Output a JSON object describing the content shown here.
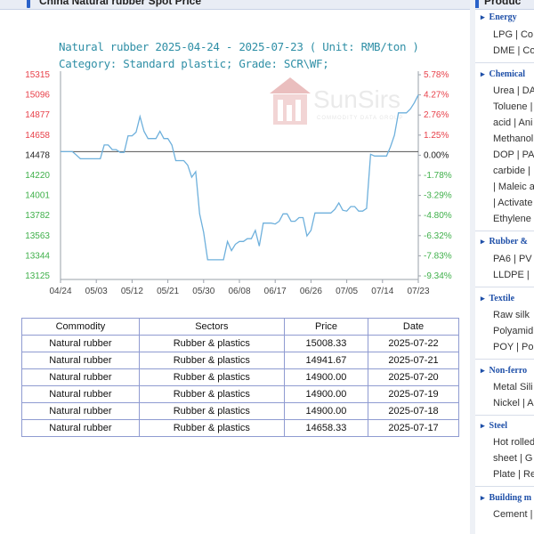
{
  "page": {
    "title": "China Natural rubber Spot Price"
  },
  "chart": {
    "title": "Natural rubber 2025-04-24 - 2025-07-23   ( Unit: RMB/ton )",
    "subtitle": "Category: Standard plastic; Grade: SCR\\WF;",
    "watermark": "SunSirs",
    "watermark_sub": "COMMODITY DATA GROUP"
  },
  "chart_data": {
    "type": "line",
    "title": "Natural rubber 2025-04-24 - 2025-07-23   ( Unit: RMB/ton )",
    "xlabel": "",
    "ylabel": "",
    "ylim": [
      13125,
      15315
    ],
    "y_ticks_left": [
      "15315",
      "15096",
      "14877",
      "14658",
      "14478",
      "14220",
      "14001",
      "13782",
      "13563",
      "13344",
      "13125"
    ],
    "y_ticks_right": [
      "5.78%",
      "4.27%",
      "2.76%",
      "1.25%",
      "0.00%",
      "-1.78%",
      "-3.29%",
      "-4.80%",
      "-6.32%",
      "-7.83%",
      "-9.34%"
    ],
    "x_ticks": [
      "04/24",
      "05/03",
      "05/12",
      "05/21",
      "05/30",
      "06/08",
      "06/17",
      "06/26",
      "07/05",
      "07/14",
      "07/23"
    ],
    "grid": false,
    "baseline": 14478,
    "series": [
      {
        "color": "#6eb0dc",
        "points": [
          [
            "04/24",
            14478
          ],
          [
            "04/25",
            14478
          ],
          [
            "04/26",
            14478
          ],
          [
            "04/27",
            14478
          ],
          [
            "04/28",
            14440
          ],
          [
            "04/29",
            14400
          ],
          [
            "04/30",
            14400
          ],
          [
            "05/01",
            14400
          ],
          [
            "05/02",
            14400
          ],
          [
            "05/03",
            14400
          ],
          [
            "05/04",
            14400
          ],
          [
            "05/05",
            14550
          ],
          [
            "05/06",
            14550
          ],
          [
            "05/07",
            14500
          ],
          [
            "05/08",
            14500
          ],
          [
            "05/09",
            14470
          ],
          [
            "05/10",
            14470
          ],
          [
            "05/11",
            14650
          ],
          [
            "05/12",
            14650
          ],
          [
            "05/13",
            14690
          ],
          [
            "05/14",
            14860
          ],
          [
            "05/15",
            14700
          ],
          [
            "05/16",
            14620
          ],
          [
            "05/17",
            14620
          ],
          [
            "05/18",
            14620
          ],
          [
            "05/19",
            14700
          ],
          [
            "05/20",
            14620
          ],
          [
            "05/21",
            14620
          ],
          [
            "05/22",
            14550
          ],
          [
            "05/23",
            14380
          ],
          [
            "05/24",
            14380
          ],
          [
            "05/25",
            14380
          ],
          [
            "05/26",
            14330
          ],
          [
            "05/27",
            14200
          ],
          [
            "05/28",
            14260
          ],
          [
            "05/29",
            13800
          ],
          [
            "05/30",
            13600
          ],
          [
            "05/31",
            13300
          ],
          [
            "06/01",
            13300
          ],
          [
            "06/02",
            13300
          ],
          [
            "06/03",
            13300
          ],
          [
            "06/04",
            13300
          ],
          [
            "06/05",
            13500
          ],
          [
            "06/06",
            13400
          ],
          [
            "06/07",
            13470
          ],
          [
            "06/08",
            13500
          ],
          [
            "06/09",
            13500
          ],
          [
            "06/10",
            13530
          ],
          [
            "06/11",
            13530
          ],
          [
            "06/12",
            13620
          ],
          [
            "06/13",
            13450
          ],
          [
            "06/14",
            13700
          ],
          [
            "06/15",
            13700
          ],
          [
            "06/16",
            13700
          ],
          [
            "06/17",
            13690
          ],
          [
            "06/18",
            13720
          ],
          [
            "06/19",
            13800
          ],
          [
            "06/20",
            13800
          ],
          [
            "06/21",
            13720
          ],
          [
            "06/22",
            13720
          ],
          [
            "06/23",
            13760
          ],
          [
            "06/24",
            13760
          ],
          [
            "06/25",
            13560
          ],
          [
            "06/26",
            13620
          ],
          [
            "06/27",
            13810
          ],
          [
            "06/28",
            13810
          ],
          [
            "06/29",
            13810
          ],
          [
            "06/30",
            13810
          ],
          [
            "07/01",
            13810
          ],
          [
            "07/02",
            13850
          ],
          [
            "07/03",
            13920
          ],
          [
            "07/04",
            13840
          ],
          [
            "07/05",
            13830
          ],
          [
            "07/06",
            13880
          ],
          [
            "07/07",
            13880
          ],
          [
            "07/08",
            13830
          ],
          [
            "07/09",
            13830
          ],
          [
            "07/10",
            13860
          ],
          [
            "07/11",
            14450
          ],
          [
            "07/12",
            14430
          ],
          [
            "07/13",
            14430
          ],
          [
            "07/14",
            14430
          ],
          [
            "07/15",
            14430
          ],
          [
            "07/16",
            14530
          ],
          [
            "07/17",
            14658.33
          ],
          [
            "07/18",
            14900
          ],
          [
            "07/19",
            14900
          ],
          [
            "07/20",
            14900
          ],
          [
            "07/21",
            14941.67
          ],
          [
            "07/22",
            15008.33
          ],
          [
            "07/23",
            15096
          ]
        ]
      }
    ]
  },
  "table": {
    "headers": [
      "Commodity",
      "Sectors",
      "Price",
      "Date"
    ],
    "rows": [
      [
        "Natural rubber",
        "Rubber & plastics",
        "15008.33",
        "2025-07-22"
      ],
      [
        "Natural rubber",
        "Rubber & plastics",
        "14941.67",
        "2025-07-21"
      ],
      [
        "Natural rubber",
        "Rubber & plastics",
        "14900.00",
        "2025-07-20"
      ],
      [
        "Natural rubber",
        "Rubber & plastics",
        "14900.00",
        "2025-07-19"
      ],
      [
        "Natural rubber",
        "Rubber & plastics",
        "14900.00",
        "2025-07-18"
      ],
      [
        "Natural rubber",
        "Rubber & plastics",
        "14658.33",
        "2025-07-17"
      ]
    ]
  },
  "sidebar": {
    "title": "Produc",
    "categories": [
      {
        "label": "Energy",
        "items": [
          "LPG | Co",
          "DME | Co"
        ]
      },
      {
        "label": "Chemical",
        "items": [
          "Urea | DA",
          "Toluene |",
          "acid | Ani",
          "Methanol",
          "DOP | PA",
          "carbide |",
          "| Maleic a",
          "| Activate",
          "Ethylene"
        ]
      },
      {
        "label": "Rubber &",
        "items": [
          "PA6 | PV",
          "LLDPE |"
        ]
      },
      {
        "label": "Textile",
        "items": [
          "Raw silk",
          "Polyamid",
          "POY | Po"
        ]
      },
      {
        "label": "Non-ferro",
        "items": [
          "Metal Sili",
          "Nickel | A"
        ]
      },
      {
        "label": "Steel",
        "items": [
          "Hot rolled",
          "sheet | G",
          "Plate | Re"
        ]
      },
      {
        "label": "Building m",
        "items": [
          "Cement |"
        ]
      }
    ]
  },
  "colors": {
    "accent": "#2a62c9",
    "title_text": "#2f8fa6",
    "line": "#6eb0dc",
    "axis_positive": "#e8424b",
    "axis_negative": "#3fb04a",
    "axis_neutral": "#222222",
    "table_border": "#8f9bd1",
    "sidebar_category": "#1e4fa8"
  }
}
